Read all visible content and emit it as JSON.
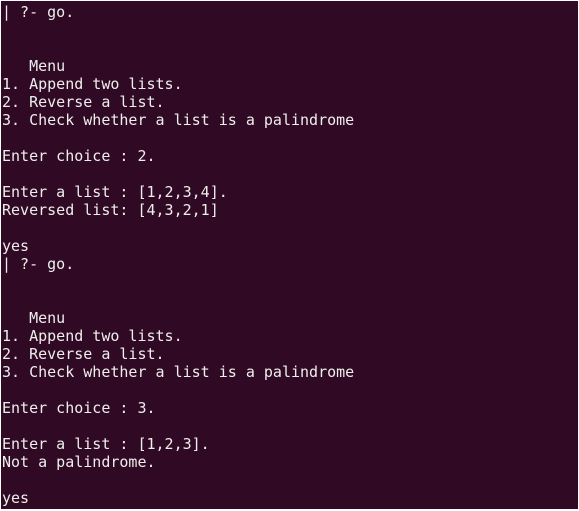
{
  "terminal": {
    "background": "#300a24",
    "foreground": "#eeeeec",
    "lines": {
      "prompt1": "| ?- go.",
      "menu_title1": "   Menu",
      "opt1_1": "1. Append two lists.",
      "opt2_1": "2. Reverse a list.",
      "opt3_1": "3. Check whether a list is a palindrome",
      "choice1": "Enter choice : 2.",
      "list1": "Enter a list : [1,2,3,4].",
      "result1": "Reversed list: [4,3,2,1]",
      "yes1": "yes",
      "prompt2": "| ?- go.",
      "menu_title2": "   Menu",
      "opt1_2": "1. Append two lists.",
      "opt2_2": "2. Reverse a list.",
      "opt3_2": "3. Check whether a list is a palindrome",
      "choice2": "Enter choice : 3.",
      "list2": "Enter a list : [1,2,3].",
      "result2": "Not a palindrome.",
      "yes2": "yes"
    }
  }
}
